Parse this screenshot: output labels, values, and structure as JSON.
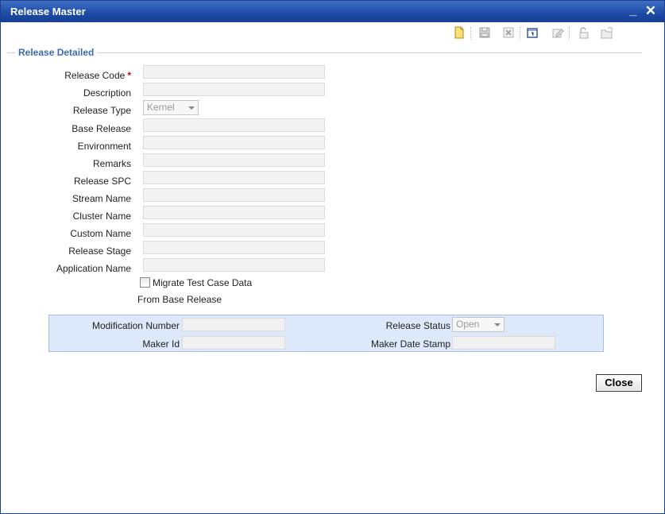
{
  "window": {
    "title": "Release Master",
    "minimize": "_",
    "close": "✕"
  },
  "toolbar": {
    "icons": [
      "new-icon",
      "save-icon",
      "delete-icon",
      "copy-icon",
      "unlock-edit-icon",
      "authorize-icon",
      "open-icon"
    ]
  },
  "section": {
    "title": "Release Detailed"
  },
  "form": {
    "release_code_label": "Release Code",
    "required_mark": "*",
    "description_label": "Description",
    "release_type_label": "Release Type",
    "release_type_value": "Kernel",
    "base_release_label": "Base Release",
    "environment_label": "Environment",
    "remarks_label": "Remarks",
    "release_spc_label": "Release SPC",
    "stream_name_label": "Stream Name",
    "cluster_name_label": "Cluster Name",
    "custom_name_label": "Custom Name",
    "release_stage_label": "Release Stage",
    "application_name_label": "Application Name",
    "migrate_label": "Migrate Test Case Data",
    "migrate_sub_label": "From Base Release"
  },
  "audit": {
    "modification_number_label": "Modification Number",
    "release_status_label": "Release Status",
    "release_status_value": "Open",
    "maker_id_label": "Maker Id",
    "maker_date_stamp_label": "Maker Date Stamp"
  },
  "footer": {
    "close_label": "Close"
  },
  "colors": {
    "titlebar": "#1c4aa5",
    "section_title": "#3a6bb3",
    "panel_bg": "#dde8fa",
    "required": "#d00000"
  }
}
